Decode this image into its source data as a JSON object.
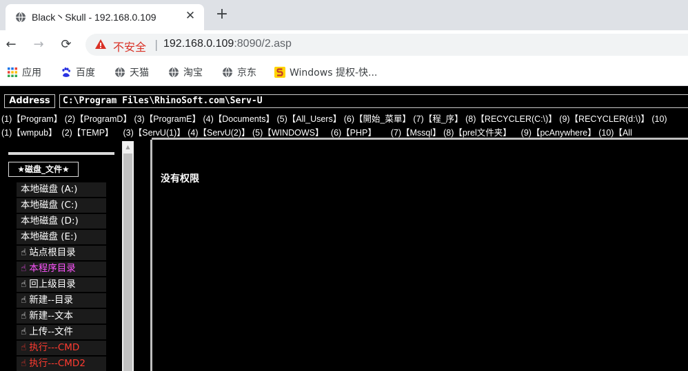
{
  "browser": {
    "tab_title": "Black丶Skull - 192.168.0.109",
    "tab_close": "✕",
    "new_tab": "+",
    "back": "←",
    "forward": "→",
    "reload": "⟳",
    "insecure_label": "不安全",
    "omni_sep": "|",
    "url_host": "192.168.0.109",
    "url_rest": ":8090/2.asp",
    "bookmarks": [
      {
        "label": "应用",
        "icon": "apps-grid-icon"
      },
      {
        "label": "百度",
        "icon": "baidu-paw-icon"
      },
      {
        "label": "天猫",
        "icon": "globe-icon"
      },
      {
        "label": "淘宝",
        "icon": "globe-icon"
      },
      {
        "label": "京东",
        "icon": "globe-icon"
      },
      {
        "label": "Windows 提权-快...",
        "icon": "windows-s-icon"
      }
    ],
    "colors": {
      "tabstrip": "#dee1e6",
      "warning_red": "#d93025"
    }
  },
  "page": {
    "address_label": "Address",
    "address_value": "C:\\Program Files\\RhinoSoft.com\\Serv-U",
    "row1_links": [
      "(1)【Program】",
      "(2)【ProgramD】",
      "(3)【ProgramE】",
      "(4)【Documents】",
      "(5)【All_Users】",
      "(6)【開始_菜單】",
      "(7)【程_序】",
      "(8)【RECYCLER(C:\\)】",
      "(9)【RECYCLER(d:\\)】",
      "(10)"
    ],
    "row2_links": [
      "(1)【wmpub】",
      "(2)【TEMP】",
      "(3)【ServU(1)】",
      "(4)【ServU(2)】",
      "(5)【WINDOWS】",
      "(6)【PHP】",
      "(7)【Mssql】",
      "(8)【prel文件夹】",
      "(9)【pcAnywhere】",
      "(10)【All"
    ],
    "disk_header": "★磁盘_文件★",
    "menu": [
      {
        "label": "本地磁盘 (A:)",
        "hand": false,
        "style": "white"
      },
      {
        "label": "本地磁盘 (C:)",
        "hand": false,
        "style": "white"
      },
      {
        "label": "本地磁盘 (D:)",
        "hand": false,
        "style": "white"
      },
      {
        "label": "本地磁盘 (E:)",
        "hand": false,
        "style": "white"
      },
      {
        "label": "站点根目录",
        "hand": true,
        "style": "white"
      },
      {
        "label": "本程序目录",
        "hand": true,
        "style": "pink"
      },
      {
        "label": "回上级目录",
        "hand": true,
        "style": "white"
      },
      {
        "label": "新建--目录",
        "hand": true,
        "style": "white"
      },
      {
        "label": "新建--文本",
        "hand": true,
        "style": "white"
      },
      {
        "label": "上传--文件",
        "hand": true,
        "style": "white"
      },
      {
        "label": "执行---CMD",
        "hand": true,
        "style": "red"
      },
      {
        "label": "执行---CMD2",
        "hand": true,
        "style": "red"
      }
    ],
    "hand_glyph": "☝",
    "content_message": "没有权限",
    "colors": {
      "pink": "#ff55ff",
      "red": "#ff3b30",
      "background": "#000000"
    }
  }
}
